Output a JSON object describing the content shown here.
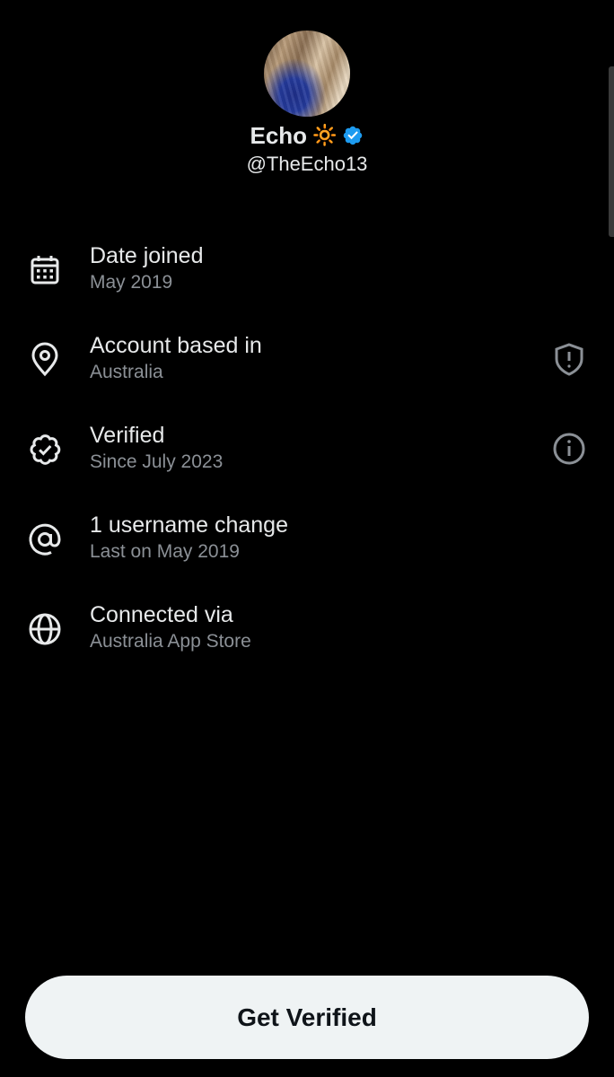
{
  "profile": {
    "display_name": "Echo",
    "emoji": "🔆",
    "handle": "@TheEcho13",
    "verified": true,
    "badge_color": "#1d9bf0"
  },
  "info_rows": [
    {
      "icon": "calendar-icon",
      "title": "Date joined",
      "subtitle": "May 2019",
      "action_icon": null
    },
    {
      "icon": "location-pin-icon",
      "title": "Account based in",
      "subtitle": "Australia",
      "action_icon": "shield-alert-icon"
    },
    {
      "icon": "verified-seal-icon",
      "title": "Verified",
      "subtitle": "Since July 2023",
      "action_icon": "info-icon"
    },
    {
      "icon": "at-sign-icon",
      "title": "1 username change",
      "subtitle": "Last on May 2019",
      "action_icon": null
    },
    {
      "icon": "globe-icon",
      "title": "Connected via",
      "subtitle": "Australia App Store",
      "action_icon": null
    }
  ],
  "cta": {
    "label": "Get Verified"
  },
  "colors": {
    "background": "#000000",
    "primary_text": "#e7e9ea",
    "secondary_text": "#8b9096",
    "icon": "#e7e9ea",
    "button_bg": "#eff3f4",
    "button_text": "#0f1419"
  }
}
